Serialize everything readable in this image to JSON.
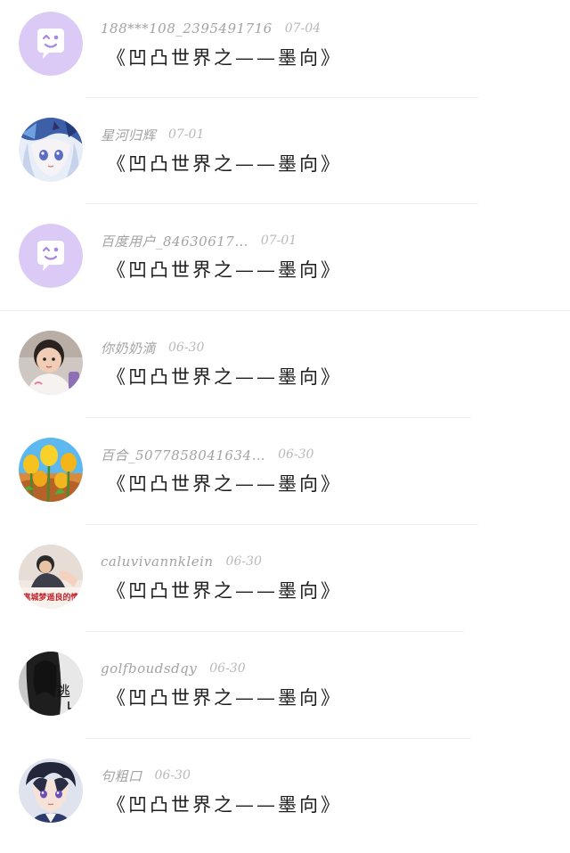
{
  "comments": [
    {
      "name": "188***108_2395491716",
      "date": "07-04",
      "text": "《凹凸世界之——墨向》",
      "avatar": "default-avatar-icon"
    },
    {
      "name": "星河归辉",
      "date": "07-01",
      "text": "《凹凸世界之——墨向》",
      "avatar": "anime-avatar"
    },
    {
      "name": "百度用户_84630617…",
      "date": "07-01",
      "text": "《凹凸世界之——墨向》",
      "avatar": "default-avatar-icon"
    },
    {
      "name": "你奶奶滴",
      "date": "06-30",
      "text": "《凹凸世界之——墨向》",
      "avatar": "child-photo-avatar"
    },
    {
      "name": "百合_5077858041634…",
      "date": "06-30",
      "text": "《凹凸世界之——墨向》",
      "avatar": "tulip-avatar"
    },
    {
      "name": "caluvivannklein",
      "date": "06-30",
      "text": "《凹凸世界之——墨向》",
      "avatar": "poster-avatar"
    },
    {
      "name": "golfboudsdqy",
      "date": "06-30",
      "text": "《凹凸世界之——墨向》",
      "avatar": "dark-portrait-avatar"
    },
    {
      "name": "句粗口",
      "date": "06-30",
      "text": "《凹凸世界之——墨向》",
      "avatar": "anime-boy-avatar"
    }
  ],
  "avatar_texts": {
    "poster": "离城梦遥良的情",
    "dark": "逃"
  },
  "colors": {
    "default_avatar_bg": "#d9c8f4",
    "name": "#a3a3a3",
    "date": "#b9b9b9",
    "comment_text": "#1e1e1e",
    "divider": "#ededed"
  }
}
